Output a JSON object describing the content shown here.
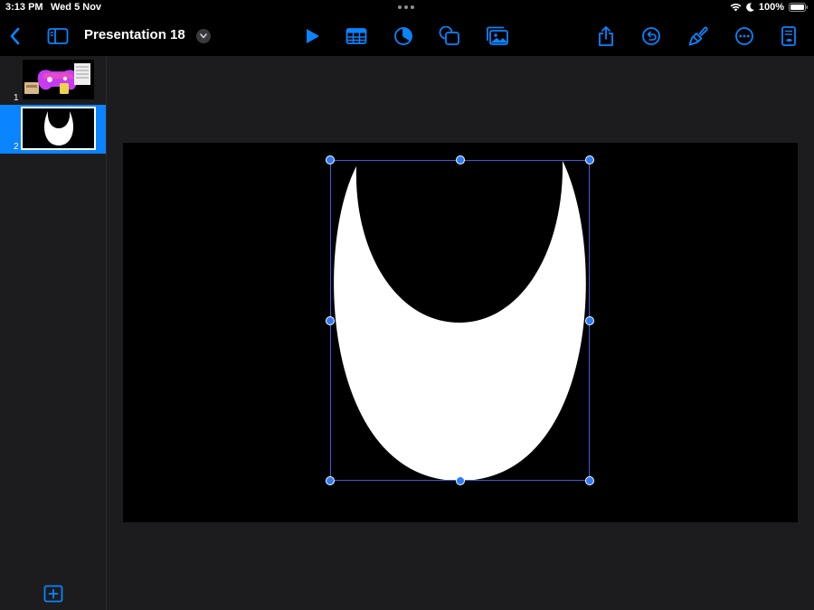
{
  "status": {
    "time": "3:13 PM",
    "date": "Wed 5 Nov",
    "battery": "100%"
  },
  "toolbar": {
    "title": "Presentation 18",
    "accent": "#0a84ff",
    "icons": [
      "chevron-left-icon",
      "sidebar-icon",
      "play-icon",
      "table-icon",
      "chart-icon",
      "shapes-icon",
      "media-icon",
      "share-icon",
      "undo-icon",
      "paintbrush-icon",
      "more-icon",
      "document-view-icon"
    ]
  },
  "navigator": {
    "slides": [
      {
        "number": "1",
        "selected": false
      },
      {
        "number": "2",
        "selected": true
      }
    ]
  },
  "canvas": {
    "slide_background": "#000000",
    "shape": "crescent",
    "shape_fill": "#ffffff",
    "selection_color": "#3a5fd9"
  }
}
